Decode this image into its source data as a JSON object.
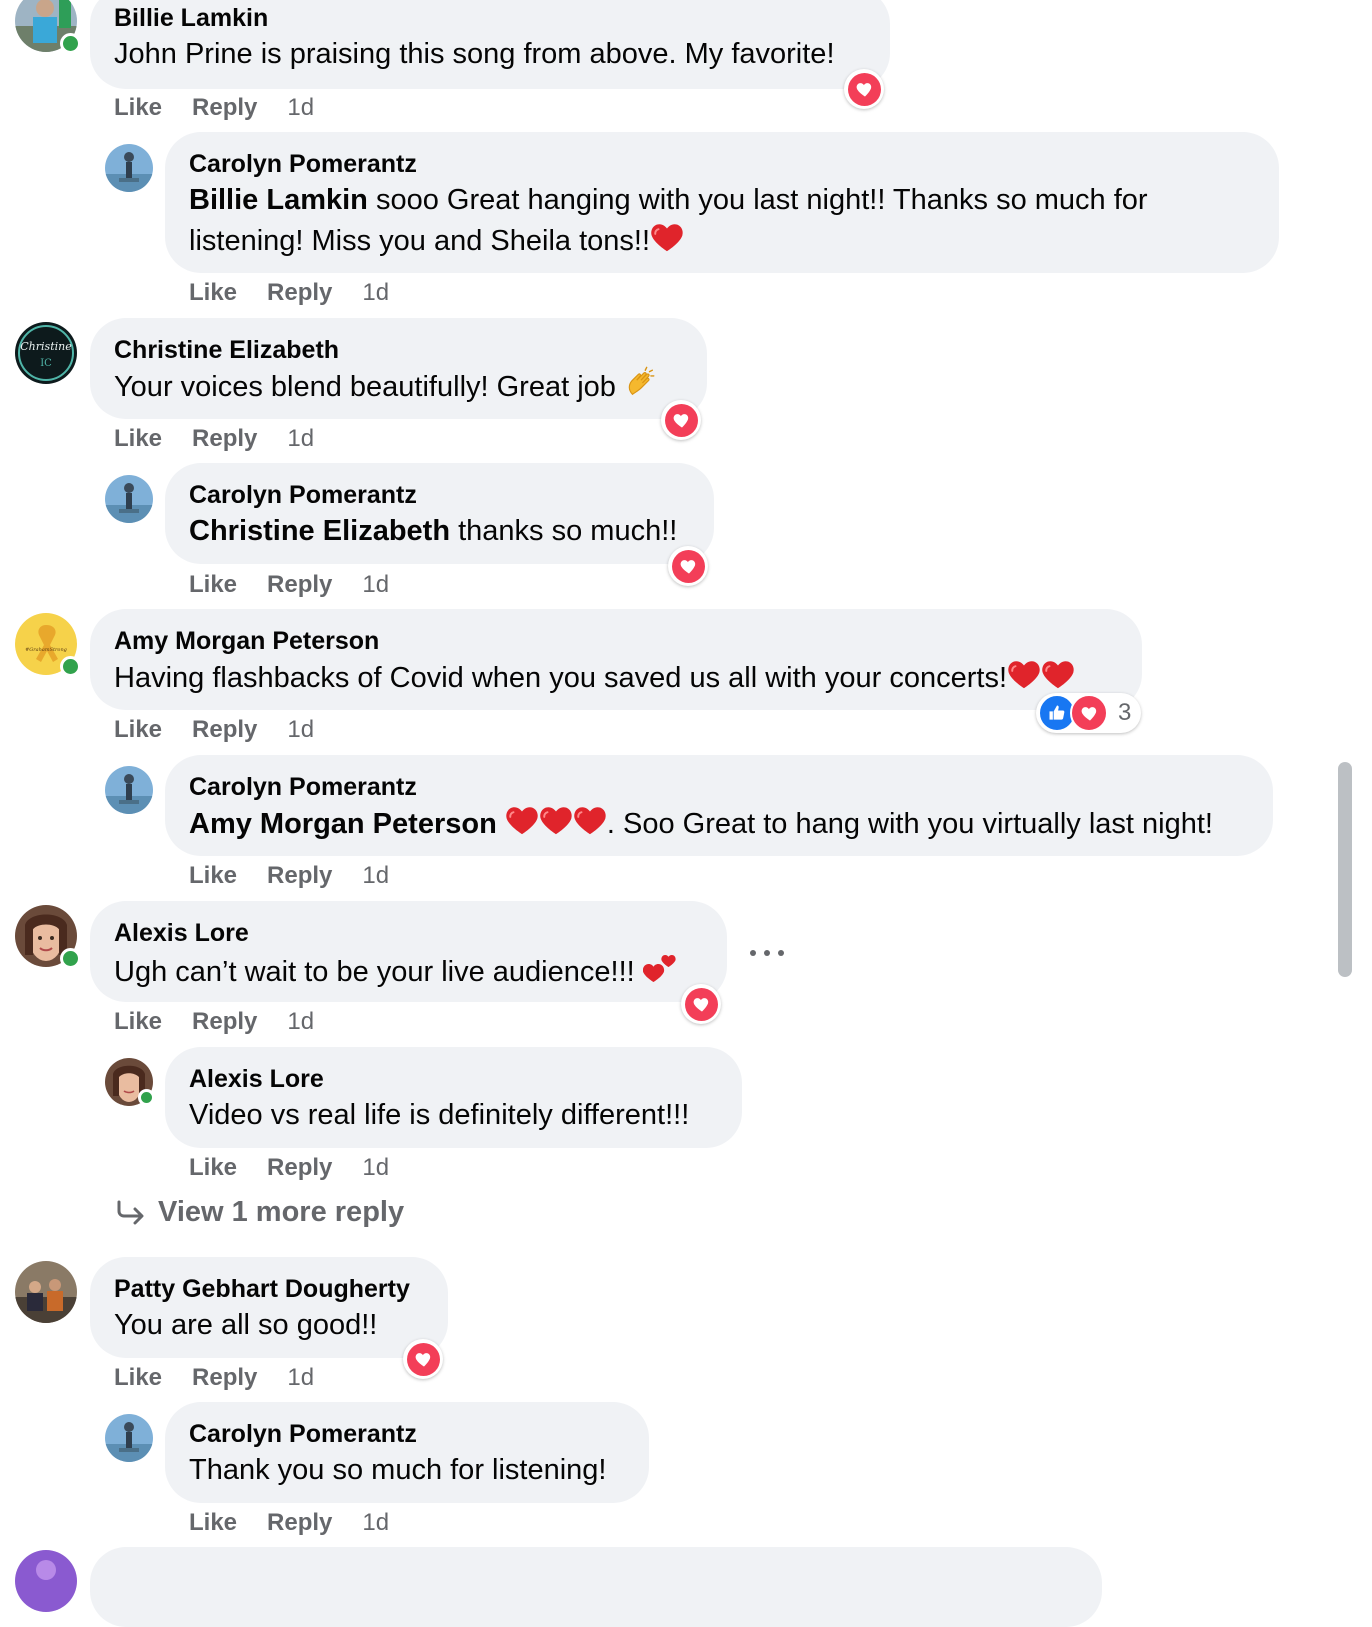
{
  "actions": {
    "like": "Like",
    "reply": "Reply"
  },
  "comments": [
    {
      "author": "Billie Lamkin",
      "text": "John Prine is praising this song from above. My favorite!",
      "time": "1d"
    },
    {
      "author": "Carolyn Pomerantz",
      "mention": "Billie Lamkin",
      "text": " sooo Great hanging with you last night!! Thanks so much for",
      "text2": "listening! Miss you and Sheila tons!!",
      "time": "1d"
    },
    {
      "author": "Christine Elizabeth",
      "text": "Your voices blend beautifully! Great job",
      "time": "1d"
    },
    {
      "author": "Carolyn Pomerantz",
      "mention": "Christine Elizabeth",
      "text": " thanks so much!!",
      "time": "1d"
    },
    {
      "author": "Amy Morgan Peterson",
      "text": "Having flashbacks of Covid when you saved us all with your concerts!",
      "time": "1d",
      "reaction_count": "3"
    },
    {
      "author": "Carolyn Pomerantz",
      "mention": "Amy Morgan Peterson",
      "text": ". Soo Great to hang with you virtually last night!",
      "time": "1d"
    },
    {
      "author": "Alexis Lore",
      "text": "Ugh can’t wait to be your live audience!!!",
      "time": "1d"
    },
    {
      "author": "Alexis Lore",
      "text": "Video vs real life is definitely different!!!",
      "time": "1d"
    },
    {
      "author": "Patty Gebhart Dougherty",
      "text": "You are all so good!!",
      "time": "1d"
    },
    {
      "author": "Carolyn Pomerantz",
      "text": "Thank you so much for listening!",
      "time": "1d"
    }
  ],
  "view_more": "View 1 more reply",
  "avatar_text": {
    "christine": "Christine",
    "christine_sub": "IC",
    "amy": "#GrahamStrong"
  },
  "colors": {
    "bubble": "#f0f2f5",
    "meta": "#65676b",
    "love": "#f33e58",
    "like": "#1877f2",
    "online": "#31a24c"
  },
  "icons": [
    "love-reaction-icon",
    "like-reaction-icon",
    "red-heart-emoji",
    "clapping-hands-emoji",
    "two-hearts-emoji",
    "reply-arrow-icon",
    "more-options-icon"
  ]
}
